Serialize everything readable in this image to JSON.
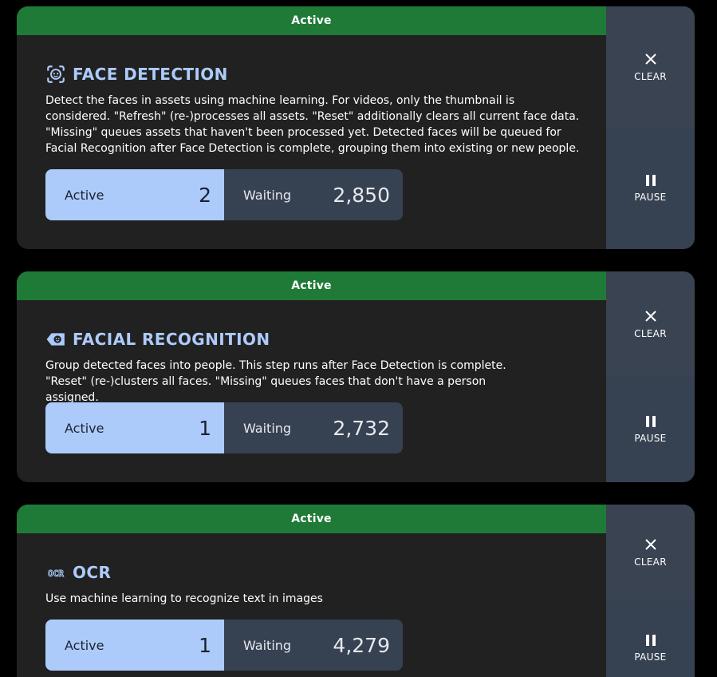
{
  "jobs": [
    {
      "status": "Active",
      "icon": "face-recognition-icon",
      "title": "FACE DETECTION",
      "description": "Detect the faces in assets using machine learning. For videos, only the thumbnail is considered. \"Refresh\" (re-)processes all assets. \"Reset\" additionally clears all current face data. \"Missing\" queues assets that haven't been processed yet. Detected faces will be queued for Facial Recognition after Face Detection is complete, grouping them into existing or new people.",
      "active_label": "Active",
      "active_count": "2",
      "waiting_label": "Waiting",
      "waiting_count": "2,850",
      "clear_label": "CLEAR",
      "pause_label": "PAUSE"
    },
    {
      "status": "Active",
      "icon": "tag-face-icon",
      "title": "FACIAL RECOGNITION",
      "description": "Group detected faces into people. This step runs after Face Detection is complete. \"Reset\" (re-)clusters all faces. \"Missing\" queues faces that don't have a person assigned.",
      "active_label": "Active",
      "active_count": "1",
      "waiting_label": "Waiting",
      "waiting_count": "2,732",
      "clear_label": "CLEAR",
      "pause_label": "PAUSE"
    },
    {
      "status": "Active",
      "icon": "ocr-icon",
      "title": "OCR",
      "description": "Use machine learning to recognize text in images",
      "active_label": "Active",
      "active_count": "1",
      "waiting_label": "Waiting",
      "waiting_count": "4,279",
      "clear_label": "CLEAR",
      "pause_label": "PAUSE"
    }
  ],
  "colors": {
    "status_active": "#1f7a37",
    "title": "#adcbfa",
    "card_bg": "#212121",
    "active_count_bg": "#adcbfa",
    "waiting_count_bg": "#364152",
    "side_button_bg": "#3a4352",
    "page_bg": "#000000"
  }
}
